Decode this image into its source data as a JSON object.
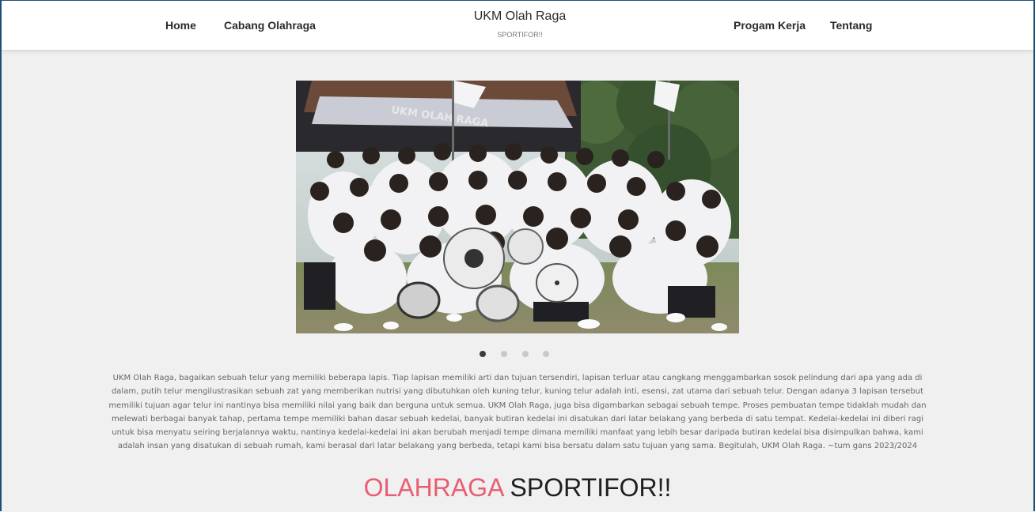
{
  "nav": {
    "left_links": [
      "Home",
      "Cabang Olahraga"
    ],
    "right_links": [
      "Progam Kerja",
      "Tentang"
    ],
    "brand_title": "UKM Olah Raga",
    "brand_subtitle": "SPORTIFOR!!"
  },
  "carousel": {
    "banner_text": "UKM OLAH RAGA",
    "image_description": "group photo of UKM members in white jackets with drums",
    "slide_count": 4,
    "active_index": 0
  },
  "about": {
    "text": "UKM Olah Raga, bagaikan sebuah telur yang memiliki beberapa lapis. Tiap lapisan memiliki arti dan tujuan tersendiri, lapisan terluar atau cangkang menggambarkan sosok pelindung dari apa yang ada di dalam, putih telur mengilustrasikan sebuah zat yang memberikan nutrisi yang dibutuhkan oleh kuning telur, kuning telur adalah inti, esensi, zat utama dari sebuah telur. Dengan adanya 3 lapisan tersebut memiliki tujuan agar telur ini nantinya bisa memiliki nilai yang baik dan berguna untuk semua. UKM Olah Raga, juga bisa digambarkan sebagai sebuah tempe. Proses pembuatan tempe tidaklah mudah dan melewati berbagai banyak tahap, pertama tempe memiliki bahan dasar sebuah kedelai, banyak butiran kedelai ini disatukan dari latar belakang yang berbeda di satu tempat. Kedelai-kedelai ini diberi ragi untuk bisa menyatu seiring berjalannya waktu, nantinya kedelai-kedelai ini akan berubah menjadi tempe dimana memiliki manfaat yang lebih besar daripada butiran kedelai bisa disimpulkan bahwa, kami adalah insan yang disatukan di sebuah rumah, kami berasal dari latar belakang yang berbeda, tetapi kami bisa bersatu dalam satu tujuan yang sama. Begitulah, UKM Olah Raga. ~tum gans 2023/2024"
  },
  "headline": {
    "accent": "OLAHRAGA",
    "rest": "SPORTIFOR!!"
  },
  "colors": {
    "accent": "#e95d73",
    "dark_text": "#1f1f1f",
    "frame_border": "#1e4f7a"
  }
}
